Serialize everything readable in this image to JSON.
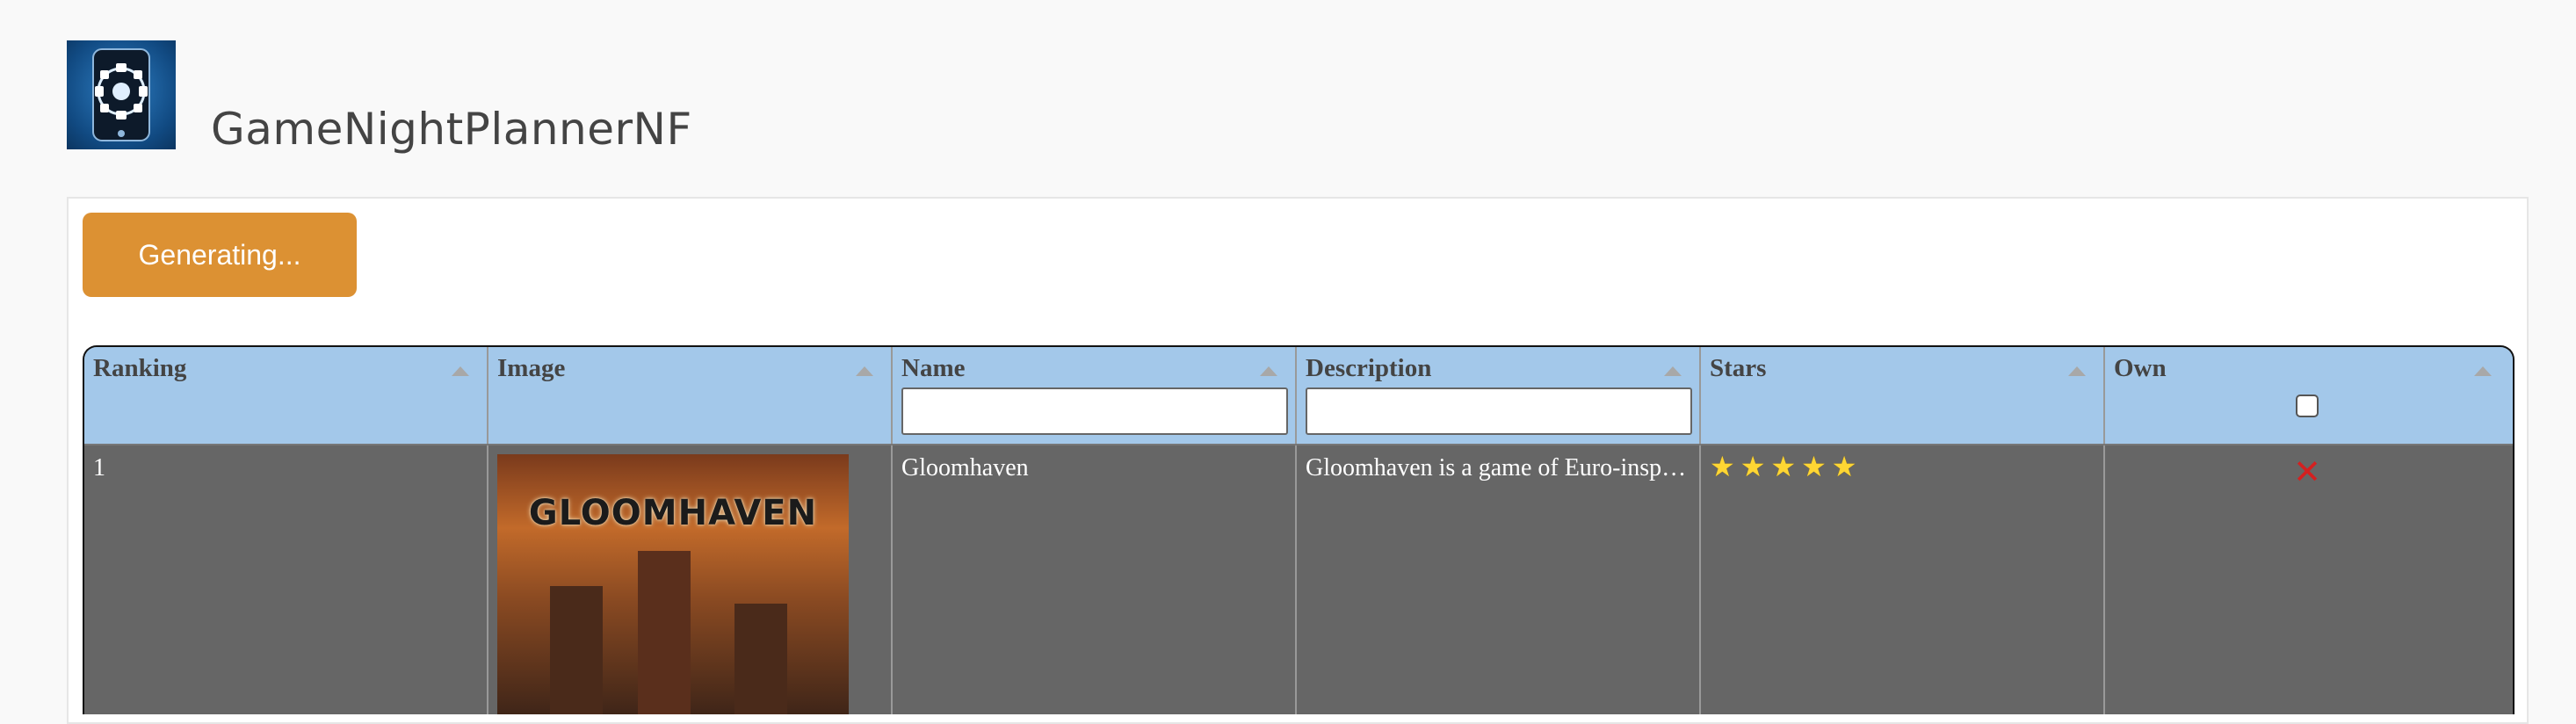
{
  "app": {
    "title": "GameNightPlannerNF",
    "logo_icon": "dice-phone-logo-icon"
  },
  "toolbar": {
    "generate_label": "Generating..."
  },
  "table": {
    "columns": [
      {
        "label": "Ranking"
      },
      {
        "label": "Image"
      },
      {
        "label": "Name",
        "filter": ""
      },
      {
        "label": "Description",
        "filter": ""
      },
      {
        "label": "Stars"
      },
      {
        "label": "Own"
      }
    ],
    "rows": [
      {
        "ranking": "1",
        "image_title": "GLOOMHAVEN",
        "name": "Gloomhaven",
        "description": "Gloomhaven is a game of Euro-inspi…",
        "stars": 5,
        "own": false
      }
    ]
  },
  "colors": {
    "accent_button": "#dc9133",
    "header_bg": "#a3c8ea",
    "row_bg": "#666666",
    "own_false": "#d42020",
    "star": "#ffd633"
  }
}
